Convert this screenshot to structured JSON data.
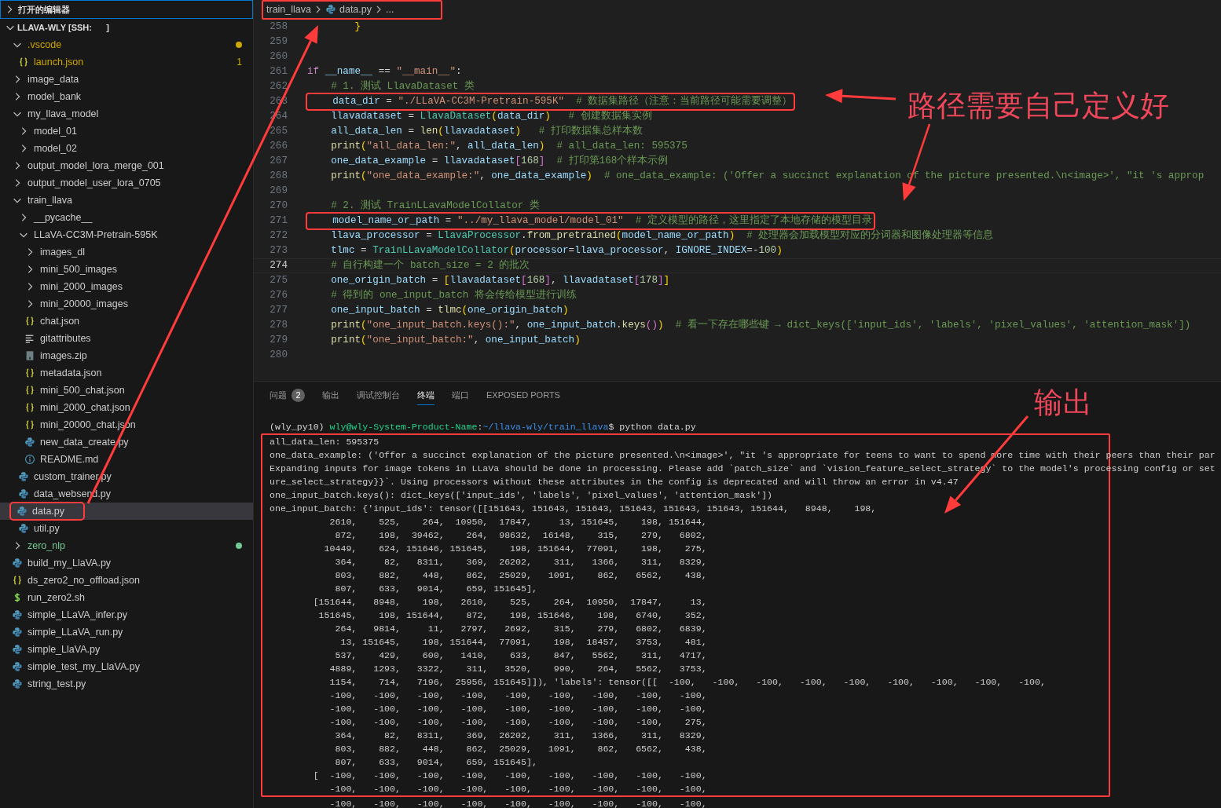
{
  "sidebar": {
    "open_editors": {
      "label": "打开的编辑器",
      "expanded": false,
      "focused": true
    },
    "root": {
      "label": "LLAVA-WLY [SSH:      ]",
      "expanded": true
    },
    "tree": [
      {
        "label": ".vscode",
        "kind": "folder",
        "expanded": true,
        "selected": false,
        "color": "#cca700",
        "dot": true,
        "children": [
          {
            "label": "launch.json",
            "kind": "json",
            "selected": false,
            "color": "#cca700",
            "badge": "1"
          }
        ]
      },
      {
        "label": "image_data",
        "kind": "folder",
        "expanded": false,
        "selected": false
      },
      {
        "label": "model_bank",
        "kind": "folder",
        "expanded": false,
        "selected": false
      },
      {
        "label": "my_llava_model",
        "kind": "folder",
        "expanded": true,
        "selected": false,
        "children": [
          {
            "label": "model_01",
            "kind": "folder",
            "expanded": false,
            "selected": false
          },
          {
            "label": "model_02",
            "kind": "folder",
            "expanded": false,
            "selected": false
          }
        ]
      },
      {
        "label": "output_model_lora_merge_001",
        "kind": "folder",
        "expanded": false,
        "selected": false
      },
      {
        "label": "output_model_user_lora_0705",
        "kind": "folder",
        "expanded": false,
        "selected": false
      },
      {
        "label": "train_llava",
        "kind": "folder",
        "expanded": true,
        "selected": false,
        "children": [
          {
            "label": "__pycache__",
            "kind": "folder",
            "expanded": false,
            "selected": false
          },
          {
            "label": "LLaVA-CC3M-Pretrain-595K",
            "kind": "folder",
            "expanded": true,
            "selected": false,
            "children": [
              {
                "label": "images_dl",
                "kind": "folder",
                "expanded": false,
                "selected": false
              },
              {
                "label": "mini_500_images",
                "kind": "folder",
                "expanded": false,
                "selected": false
              },
              {
                "label": "mini_2000_images",
                "kind": "folder",
                "expanded": false,
                "selected": false
              },
              {
                "label": "mini_20000_images",
                "kind": "folder",
                "expanded": false,
                "selected": false
              },
              {
                "label": "chat.json",
                "kind": "json",
                "selected": false
              },
              {
                "label": "gitattributes",
                "kind": "text",
                "selected": false
              },
              {
                "label": "images.zip",
                "kind": "zip",
                "selected": false
              },
              {
                "label": "metadata.json",
                "kind": "json",
                "selected": false
              },
              {
                "label": "mini_500_chat.json",
                "kind": "json",
                "selected": false
              },
              {
                "label": "mini_2000_chat.json",
                "kind": "json",
                "selected": false
              },
              {
                "label": "mini_20000_chat.json",
                "kind": "json",
                "selected": false
              },
              {
                "label": "new_data_create.py",
                "kind": "python",
                "selected": false
              },
              {
                "label": "README.md",
                "kind": "markdown",
                "selected": false
              }
            ]
          },
          {
            "label": "custom_trainer.py",
            "kind": "python",
            "selected": false
          },
          {
            "label": "data_websend.py",
            "kind": "python",
            "selected": false
          },
          {
            "label": "data.py",
            "kind": "python",
            "selected": true,
            "annotated": true
          },
          {
            "label": "util.py",
            "kind": "python",
            "selected": false
          }
        ]
      },
      {
        "label": "zero_nlp",
        "kind": "folder",
        "expanded": false,
        "selected": false,
        "color": "#73c991",
        "dot": true
      },
      {
        "label": "build_my_LlaVA.py",
        "kind": "python",
        "selected": false
      },
      {
        "label": "ds_zero2_no_offload.json",
        "kind": "json",
        "selected": false
      },
      {
        "label": "run_zero2.sh",
        "kind": "shell",
        "selected": false
      },
      {
        "label": "simple_LLaVA_infer.py",
        "kind": "python",
        "selected": false
      },
      {
        "label": "simple_LLaVA_run.py",
        "kind": "python",
        "selected": false
      },
      {
        "label": "simple_LlaVA.py",
        "kind": "python",
        "selected": false
      },
      {
        "label": "simple_test_my_LlaVA.py",
        "kind": "python",
        "selected": false
      },
      {
        "label": "string_test.py",
        "kind": "python",
        "selected": false
      }
    ]
  },
  "breadcrumb": {
    "annotated": true,
    "items": [
      {
        "label": "train_llava",
        "kind": "folder"
      },
      {
        "label": "data.py",
        "kind": "python"
      },
      {
        "label": "...",
        "kind": "more"
      }
    ]
  },
  "editor": {
    "lines": [
      {
        "number": "258",
        "current": false,
        "tokens": [
          {
            "kind": "bracket",
            "text": "        }"
          }
        ]
      },
      {
        "number": "259",
        "current": false
      },
      {
        "number": "260",
        "current": false
      },
      {
        "number": "261",
        "current": false,
        "tokens": [
          {
            "kind": "keyword",
            "text": "if"
          },
          {
            "kind": "variable",
            "text": " __name__"
          },
          {
            "kind": "plain",
            "text": " == "
          },
          {
            "kind": "string",
            "text": "\"__main__\""
          },
          {
            "kind": "plain",
            "text": ":"
          }
        ]
      },
      {
        "number": "262",
        "current": false,
        "tokens": [
          {
            "kind": "comment",
            "text": "    # 1. 测试 LlavaDataset 类"
          }
        ]
      },
      {
        "number": "263",
        "current": false,
        "boxed": true,
        "tokens": [
          {
            "kind": "variable",
            "text": "    data_dir"
          },
          {
            "kind": "plain",
            "text": " = "
          },
          {
            "kind": "string",
            "text": "\"./LLaVA-CC3M-Pretrain-595K\""
          },
          {
            "kind": "comment",
            "text": "  # 数据集路径（注意：当前路径可能需要调整）"
          }
        ]
      },
      {
        "number": "264",
        "current": false,
        "tokens": [
          {
            "kind": "variable",
            "text": "    llavadataset"
          },
          {
            "kind": "plain",
            "text": " = "
          },
          {
            "kind": "class",
            "text": "LlavaDataset"
          },
          {
            "kind": "bracket",
            "text": "("
          },
          {
            "kind": "variable",
            "text": "data_dir"
          },
          {
            "kind": "bracket",
            "text": ")"
          },
          {
            "kind": "comment",
            "text": "   # 创建数据集实例"
          }
        ]
      },
      {
        "number": "265",
        "current": false,
        "tokens": [
          {
            "kind": "variable",
            "text": "    all_data_len"
          },
          {
            "kind": "plain",
            "text": " = "
          },
          {
            "kind": "function",
            "text": "len"
          },
          {
            "kind": "bracket",
            "text": "("
          },
          {
            "kind": "variable",
            "text": "llavadataset"
          },
          {
            "kind": "bracket",
            "text": ")"
          },
          {
            "kind": "comment",
            "text": "   # 打印数据集总样本数"
          }
        ]
      },
      {
        "number": "266",
        "current": false,
        "tokens": [
          {
            "kind": "function",
            "text": "    print"
          },
          {
            "kind": "bracket",
            "text": "("
          },
          {
            "kind": "string",
            "text": "\"all_data_len:\""
          },
          {
            "kind": "plain",
            "text": ", "
          },
          {
            "kind": "variable",
            "text": "all_data_len"
          },
          {
            "kind": "bracket",
            "text": ")"
          },
          {
            "kind": "comment",
            "text": "  # all_data_len: 595375"
          }
        ]
      },
      {
        "number": "267",
        "current": false,
        "tokens": [
          {
            "kind": "variable",
            "text": "    one_data_example"
          },
          {
            "kind": "plain",
            "text": " = "
          },
          {
            "kind": "variable",
            "text": "llavadataset"
          },
          {
            "kind": "bracket2",
            "text": "["
          },
          {
            "kind": "number",
            "text": "168"
          },
          {
            "kind": "bracket2",
            "text": "]"
          },
          {
            "kind": "comment",
            "text": "  # 打印第168个样本示例"
          }
        ]
      },
      {
        "number": "268",
        "current": false,
        "tokens": [
          {
            "kind": "function",
            "text": "    print"
          },
          {
            "kind": "bracket",
            "text": "("
          },
          {
            "kind": "string",
            "text": "\"one_data_example:\""
          },
          {
            "kind": "plain",
            "text": ", "
          },
          {
            "kind": "variable",
            "text": "one_data_example"
          },
          {
            "kind": "bracket",
            "text": ")"
          },
          {
            "kind": "comment",
            "text": "  # one_data_example: ('Offer a succinct explanation of the picture presented.\\n<image>', \"it 's approp"
          }
        ]
      },
      {
        "number": "269",
        "current": false
      },
      {
        "number": "270",
        "current": false,
        "tokens": [
          {
            "kind": "comment",
            "text": "    # 2. 测试 TrainLLavaModelCollator 类"
          }
        ]
      },
      {
        "number": "271",
        "current": false,
        "boxed": true,
        "tokens": [
          {
            "kind": "variable",
            "text": "    model_name_or_path"
          },
          {
            "kind": "plain",
            "text": " = "
          },
          {
            "kind": "string",
            "text": "\"../my_llava_model/model_01\""
          },
          {
            "kind": "comment",
            "text": "  # 定义模型的路径，这里指定了本地存储的模型目录"
          }
        ]
      },
      {
        "number": "272",
        "current": false,
        "tokens": [
          {
            "kind": "variable",
            "text": "    llava_processor"
          },
          {
            "kind": "plain",
            "text": " = "
          },
          {
            "kind": "class",
            "text": "LlavaProcessor"
          },
          {
            "kind": "plain",
            "text": "."
          },
          {
            "kind": "function",
            "text": "from_pretrained"
          },
          {
            "kind": "bracket",
            "text": "("
          },
          {
            "kind": "variable",
            "text": "model_name_or_path"
          },
          {
            "kind": "bracket",
            "text": ")"
          },
          {
            "kind": "comment",
            "text": "  # 处理器会加载模型对应的分词器和图像处理器等信息"
          }
        ]
      },
      {
        "number": "273",
        "current": false,
        "tokens": [
          {
            "kind": "variable",
            "text": "    tlmc"
          },
          {
            "kind": "plain",
            "text": " = "
          },
          {
            "kind": "class",
            "text": "TrainLLavaModelCollator"
          },
          {
            "kind": "bracket",
            "text": "("
          },
          {
            "kind": "variable",
            "text": "processor"
          },
          {
            "kind": "plain",
            "text": "="
          },
          {
            "kind": "variable",
            "text": "llava_processor"
          },
          {
            "kind": "plain",
            "text": ", "
          },
          {
            "kind": "variable",
            "text": "IGNORE_INDEX"
          },
          {
            "kind": "plain",
            "text": "=-"
          },
          {
            "kind": "number",
            "text": "100"
          },
          {
            "kind": "bracket",
            "text": ")"
          }
        ]
      },
      {
        "number": "274",
        "current": true,
        "tokens": [
          {
            "kind": "comment",
            "text": "    # 自行构建一个 batch_size = 2 的批次"
          }
        ]
      },
      {
        "number": "275",
        "current": false,
        "tokens": [
          {
            "kind": "variable",
            "text": "    one_origin_batch"
          },
          {
            "kind": "plain",
            "text": " = "
          },
          {
            "kind": "bracket",
            "text": "["
          },
          {
            "kind": "variable",
            "text": "llavadataset"
          },
          {
            "kind": "bracket2",
            "text": "["
          },
          {
            "kind": "number",
            "text": "168"
          },
          {
            "kind": "bracket2",
            "text": "]"
          },
          {
            "kind": "plain",
            "text": ", "
          },
          {
            "kind": "variable",
            "text": "llavadataset"
          },
          {
            "kind": "bracket2",
            "text": "["
          },
          {
            "kind": "number",
            "text": "178"
          },
          {
            "kind": "bracket2",
            "text": "]"
          },
          {
            "kind": "bracket",
            "text": "]"
          }
        ]
      },
      {
        "number": "276",
        "current": false,
        "tokens": [
          {
            "kind": "comment",
            "text": "    # 得到的 one_input_batch 将会传给模型进行训练"
          }
        ]
      },
      {
        "number": "277",
        "current": false,
        "tokens": [
          {
            "kind": "variable",
            "text": "    one_input_batch"
          },
          {
            "kind": "plain",
            "text": " = "
          },
          {
            "kind": "function",
            "text": "tlmc"
          },
          {
            "kind": "bracket",
            "text": "("
          },
          {
            "kind": "variable",
            "text": "one_origin_batch"
          },
          {
            "kind": "bracket",
            "text": ")"
          }
        ]
      },
      {
        "number": "278",
        "current": false,
        "tokens": [
          {
            "kind": "function",
            "text": "    print"
          },
          {
            "kind": "bracket",
            "text": "("
          },
          {
            "kind": "string",
            "text": "\"one_input_batch.keys():\""
          },
          {
            "kind": "plain",
            "text": ", "
          },
          {
            "kind": "variable",
            "text": "one_input_batch"
          },
          {
            "kind": "plain",
            "text": "."
          },
          {
            "kind": "function",
            "text": "keys"
          },
          {
            "kind": "bracket2",
            "text": "()"
          },
          {
            "kind": "bracket",
            "text": ")"
          },
          {
            "kind": "comment",
            "text": "  # 看一下存在哪些键 → dict_keys(['input_ids', 'labels', 'pixel_values', 'attention_mask'])"
          }
        ]
      },
      {
        "number": "279",
        "current": false,
        "tokens": [
          {
            "kind": "function",
            "text": "    print"
          },
          {
            "kind": "bracket",
            "text": "("
          },
          {
            "kind": "string",
            "text": "\"one_input_batch:\""
          },
          {
            "kind": "plain",
            "text": ", "
          },
          {
            "kind": "variable",
            "text": "one_input_batch"
          },
          {
            "kind": "bracket",
            "text": ")"
          }
        ]
      },
      {
        "number": "280",
        "current": false
      }
    ]
  },
  "panel": {
    "tabs": [
      {
        "label": "问题",
        "badge": "2",
        "selected": false
      },
      {
        "label": "输出",
        "selected": false
      },
      {
        "label": "调试控制台",
        "selected": false
      },
      {
        "label": "终端",
        "selected": true
      },
      {
        "label": "端口",
        "selected": false
      },
      {
        "label": "EXPOSED PORTS",
        "selected": false
      }
    ],
    "terminal": {
      "prompt": [
        {
          "kind": "plain",
          "text": "(wly_py10) "
        },
        {
          "kind": "user",
          "text": "wly@wly-System-Product-Name"
        },
        {
          "kind": "plain",
          "text": ":"
        },
        {
          "kind": "path",
          "text": "~/llava-wly/train_llava"
        },
        {
          "kind": "plain",
          "text": "$ python data.py"
        }
      ],
      "lines": [
        {
          "boxed": true,
          "text": "all_data_len: 595375"
        },
        {
          "boxed": true,
          "text": "one_data_example: ('Offer a succinct explanation of the picture presented.\\n<image>', \"it 's appropriate for teens to want to spend more time with their peers than their par"
        },
        {
          "boxed": true,
          "text": "Expanding inputs for image tokens in LLaVa should be done in processing. Please add `patch_size` and `vision_feature_select_strategy` to the model's processing config or set"
        },
        {
          "boxed": true,
          "text": "ure_select_strategy}}`. Using processors without these attributes in the config is deprecated and will throw an error in v4.47"
        },
        {
          "boxed": true,
          "text": "one_input_batch.keys(): dict_keys(['input_ids', 'labels', 'pixel_values', 'attention_mask'])"
        },
        {
          "boxed": true,
          "text": "one_input_batch: {'input_ids': tensor([[151643, 151643, 151643, 151643, 151643, 151643, 151644,   8948,    198,"
        },
        {
          "boxed": true,
          "text": "           2610,    525,    264,  10950,  17847,     13, 151645,    198, 151644,"
        },
        {
          "boxed": true,
          "text": "            872,    198,  39462,    264,  98632,  16148,    315,    279,   6802,"
        },
        {
          "boxed": true,
          "text": "          10449,    624, 151646, 151645,    198, 151644,  77091,    198,    275,"
        },
        {
          "boxed": true,
          "text": "            364,     82,   8311,    369,  26202,    311,   1366,    311,   8329,"
        },
        {
          "boxed": true,
          "text": "            803,    882,    448,    862,  25029,   1091,    862,   6562,    438,"
        },
        {
          "boxed": true,
          "text": "            807,    633,   9014,    659, 151645],"
        },
        {
          "boxed": true,
          "text": "        [151644,   8948,    198,   2610,    525,    264,  10950,  17847,     13,"
        },
        {
          "boxed": true,
          "text": "         151645,    198, 151644,    872,    198, 151646,    198,   6740,    352,"
        },
        {
          "boxed": true,
          "text": "            264,   9814,     11,   2797,   2692,    315,    279,   6802,   6839,"
        },
        {
          "boxed": true,
          "text": "             13, 151645,    198, 151644,  77091,    198,  18457,   3753,    481,"
        },
        {
          "boxed": true,
          "text": "            537,    429,    600,   1410,    633,    847,   5562,    311,   4717,"
        },
        {
          "boxed": true,
          "text": "           4889,   1293,   3322,    311,   3520,    990,    264,   5562,   3753,"
        },
        {
          "boxed": true,
          "text": "           1154,    714,   7196,  25956, 151645]]), 'labels': tensor([[  -100,   -100,   -100,   -100,   -100,   -100,   -100,   -100,   -100,"
        },
        {
          "boxed": true,
          "text": "           -100,   -100,   -100,   -100,   -100,   -100,   -100,   -100,   -100,"
        },
        {
          "boxed": true,
          "text": "           -100,   -100,   -100,   -100,   -100,   -100,   -100,   -100,   -100,"
        },
        {
          "boxed": true,
          "text": "           -100,   -100,   -100,   -100,   -100,   -100,   -100,   -100,    275,"
        },
        {
          "boxed": true,
          "text": "            364,     82,   8311,    369,  26202,    311,   1366,    311,   8329,"
        },
        {
          "boxed": true,
          "text": "            803,    882,    448,    862,  25029,   1091,    862,   6562,    438,"
        },
        {
          "boxed": true,
          "text": "            807,    633,   9014,    659, 151645],"
        },
        {
          "boxed": true,
          "text": "        [  -100,   -100,   -100,   -100,   -100,   -100,   -100,   -100,   -100,"
        },
        {
          "boxed": true,
          "text": "           -100,   -100,   -100,   -100,   -100,   -100,   -100,   -100,   -100,"
        },
        {
          "boxed": false,
          "text": "           -100,   -100,   -100,   -100,   -100,   -100,   -100,   -100,   -100,"
        }
      ]
    }
  },
  "annotations": [
    {
      "kind": "path-note",
      "text": "路径需要自己定义好"
    },
    {
      "kind": "output-note",
      "text": "输出"
    }
  ]
}
